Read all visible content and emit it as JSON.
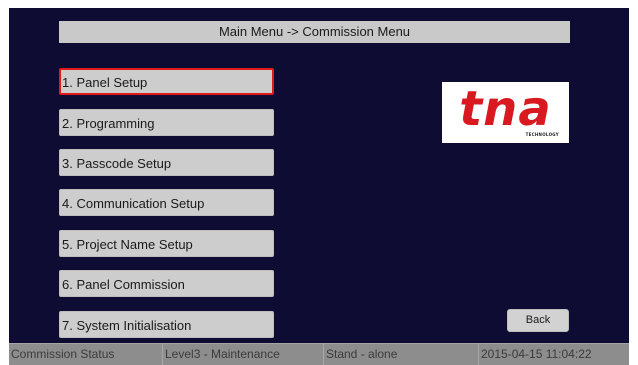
{
  "title_bar": "Main Menu -> Commission Menu",
  "menu": [
    {
      "label": "1. Panel Setup",
      "selected": true
    },
    {
      "label": "2. Programming",
      "selected": false
    },
    {
      "label": "3. Passcode Setup",
      "selected": false
    },
    {
      "label": "4. Communication Setup",
      "selected": false
    },
    {
      "label": "5. Project Name Setup",
      "selected": false
    },
    {
      "label": "6. Panel Commission",
      "selected": false
    },
    {
      "label": "7. System Initialisation",
      "selected": false
    }
  ],
  "logo": {
    "text": "tna",
    "subtext": "TECHNOLOGY",
    "color": "#d81920"
  },
  "back_button": "Back",
  "status_bar": {
    "status_label": "Commission Status",
    "access_level": "Level3 - Maintenance",
    "mode": "Stand - alone",
    "datetime": "2015-04-15 11:04:22"
  },
  "colors": {
    "panel_background": "#0e0c33",
    "button_background": "#cdcdcd",
    "selected_border": "#e21a1a",
    "status_bar_background": "#8d8d8d"
  }
}
